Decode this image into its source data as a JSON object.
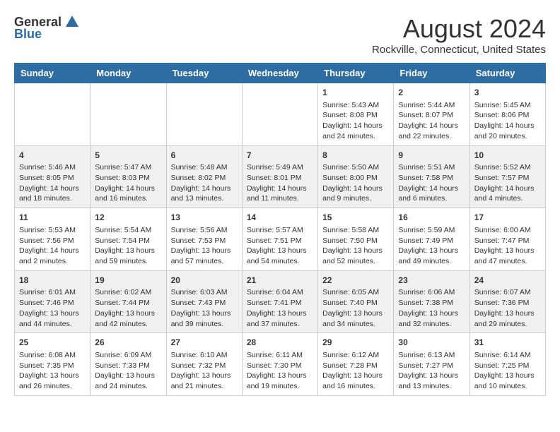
{
  "header": {
    "logo_general": "General",
    "logo_blue": "Blue",
    "month_year": "August 2024",
    "location": "Rockville, Connecticut, United States"
  },
  "days_of_week": [
    "Sunday",
    "Monday",
    "Tuesday",
    "Wednesday",
    "Thursday",
    "Friday",
    "Saturday"
  ],
  "weeks": [
    [
      {
        "day": "",
        "sunrise": "",
        "sunset": "",
        "daylight": ""
      },
      {
        "day": "",
        "sunrise": "",
        "sunset": "",
        "daylight": ""
      },
      {
        "day": "",
        "sunrise": "",
        "sunset": "",
        "daylight": ""
      },
      {
        "day": "",
        "sunrise": "",
        "sunset": "",
        "daylight": ""
      },
      {
        "day": "1",
        "sunrise": "Sunrise: 5:43 AM",
        "sunset": "Sunset: 8:08 PM",
        "daylight": "Daylight: 14 hours and 24 minutes."
      },
      {
        "day": "2",
        "sunrise": "Sunrise: 5:44 AM",
        "sunset": "Sunset: 8:07 PM",
        "daylight": "Daylight: 14 hours and 22 minutes."
      },
      {
        "day": "3",
        "sunrise": "Sunrise: 5:45 AM",
        "sunset": "Sunset: 8:06 PM",
        "daylight": "Daylight: 14 hours and 20 minutes."
      }
    ],
    [
      {
        "day": "4",
        "sunrise": "Sunrise: 5:46 AM",
        "sunset": "Sunset: 8:05 PM",
        "daylight": "Daylight: 14 hours and 18 minutes."
      },
      {
        "day": "5",
        "sunrise": "Sunrise: 5:47 AM",
        "sunset": "Sunset: 8:03 PM",
        "daylight": "Daylight: 14 hours and 16 minutes."
      },
      {
        "day": "6",
        "sunrise": "Sunrise: 5:48 AM",
        "sunset": "Sunset: 8:02 PM",
        "daylight": "Daylight: 14 hours and 13 minutes."
      },
      {
        "day": "7",
        "sunrise": "Sunrise: 5:49 AM",
        "sunset": "Sunset: 8:01 PM",
        "daylight": "Daylight: 14 hours and 11 minutes."
      },
      {
        "day": "8",
        "sunrise": "Sunrise: 5:50 AM",
        "sunset": "Sunset: 8:00 PM",
        "daylight": "Daylight: 14 hours and 9 minutes."
      },
      {
        "day": "9",
        "sunrise": "Sunrise: 5:51 AM",
        "sunset": "Sunset: 7:58 PM",
        "daylight": "Daylight: 14 hours and 6 minutes."
      },
      {
        "day": "10",
        "sunrise": "Sunrise: 5:52 AM",
        "sunset": "Sunset: 7:57 PM",
        "daylight": "Daylight: 14 hours and 4 minutes."
      }
    ],
    [
      {
        "day": "11",
        "sunrise": "Sunrise: 5:53 AM",
        "sunset": "Sunset: 7:56 PM",
        "daylight": "Daylight: 14 hours and 2 minutes."
      },
      {
        "day": "12",
        "sunrise": "Sunrise: 5:54 AM",
        "sunset": "Sunset: 7:54 PM",
        "daylight": "Daylight: 13 hours and 59 minutes."
      },
      {
        "day": "13",
        "sunrise": "Sunrise: 5:56 AM",
        "sunset": "Sunset: 7:53 PM",
        "daylight": "Daylight: 13 hours and 57 minutes."
      },
      {
        "day": "14",
        "sunrise": "Sunrise: 5:57 AM",
        "sunset": "Sunset: 7:51 PM",
        "daylight": "Daylight: 13 hours and 54 minutes."
      },
      {
        "day": "15",
        "sunrise": "Sunrise: 5:58 AM",
        "sunset": "Sunset: 7:50 PM",
        "daylight": "Daylight: 13 hours and 52 minutes."
      },
      {
        "day": "16",
        "sunrise": "Sunrise: 5:59 AM",
        "sunset": "Sunset: 7:49 PM",
        "daylight": "Daylight: 13 hours and 49 minutes."
      },
      {
        "day": "17",
        "sunrise": "Sunrise: 6:00 AM",
        "sunset": "Sunset: 7:47 PM",
        "daylight": "Daylight: 13 hours and 47 minutes."
      }
    ],
    [
      {
        "day": "18",
        "sunrise": "Sunrise: 6:01 AM",
        "sunset": "Sunset: 7:46 PM",
        "daylight": "Daylight: 13 hours and 44 minutes."
      },
      {
        "day": "19",
        "sunrise": "Sunrise: 6:02 AM",
        "sunset": "Sunset: 7:44 PM",
        "daylight": "Daylight: 13 hours and 42 minutes."
      },
      {
        "day": "20",
        "sunrise": "Sunrise: 6:03 AM",
        "sunset": "Sunset: 7:43 PM",
        "daylight": "Daylight: 13 hours and 39 minutes."
      },
      {
        "day": "21",
        "sunrise": "Sunrise: 6:04 AM",
        "sunset": "Sunset: 7:41 PM",
        "daylight": "Daylight: 13 hours and 37 minutes."
      },
      {
        "day": "22",
        "sunrise": "Sunrise: 6:05 AM",
        "sunset": "Sunset: 7:40 PM",
        "daylight": "Daylight: 13 hours and 34 minutes."
      },
      {
        "day": "23",
        "sunrise": "Sunrise: 6:06 AM",
        "sunset": "Sunset: 7:38 PM",
        "daylight": "Daylight: 13 hours and 32 minutes."
      },
      {
        "day": "24",
        "sunrise": "Sunrise: 6:07 AM",
        "sunset": "Sunset: 7:36 PM",
        "daylight": "Daylight: 13 hours and 29 minutes."
      }
    ],
    [
      {
        "day": "25",
        "sunrise": "Sunrise: 6:08 AM",
        "sunset": "Sunset: 7:35 PM",
        "daylight": "Daylight: 13 hours and 26 minutes."
      },
      {
        "day": "26",
        "sunrise": "Sunrise: 6:09 AM",
        "sunset": "Sunset: 7:33 PM",
        "daylight": "Daylight: 13 hours and 24 minutes."
      },
      {
        "day": "27",
        "sunrise": "Sunrise: 6:10 AM",
        "sunset": "Sunset: 7:32 PM",
        "daylight": "Daylight: 13 hours and 21 minutes."
      },
      {
        "day": "28",
        "sunrise": "Sunrise: 6:11 AM",
        "sunset": "Sunset: 7:30 PM",
        "daylight": "Daylight: 13 hours and 19 minutes."
      },
      {
        "day": "29",
        "sunrise": "Sunrise: 6:12 AM",
        "sunset": "Sunset: 7:28 PM",
        "daylight": "Daylight: 13 hours and 16 minutes."
      },
      {
        "day": "30",
        "sunrise": "Sunrise: 6:13 AM",
        "sunset": "Sunset: 7:27 PM",
        "daylight": "Daylight: 13 hours and 13 minutes."
      },
      {
        "day": "31",
        "sunrise": "Sunrise: 6:14 AM",
        "sunset": "Sunset: 7:25 PM",
        "daylight": "Daylight: 13 hours and 10 minutes."
      }
    ]
  ]
}
